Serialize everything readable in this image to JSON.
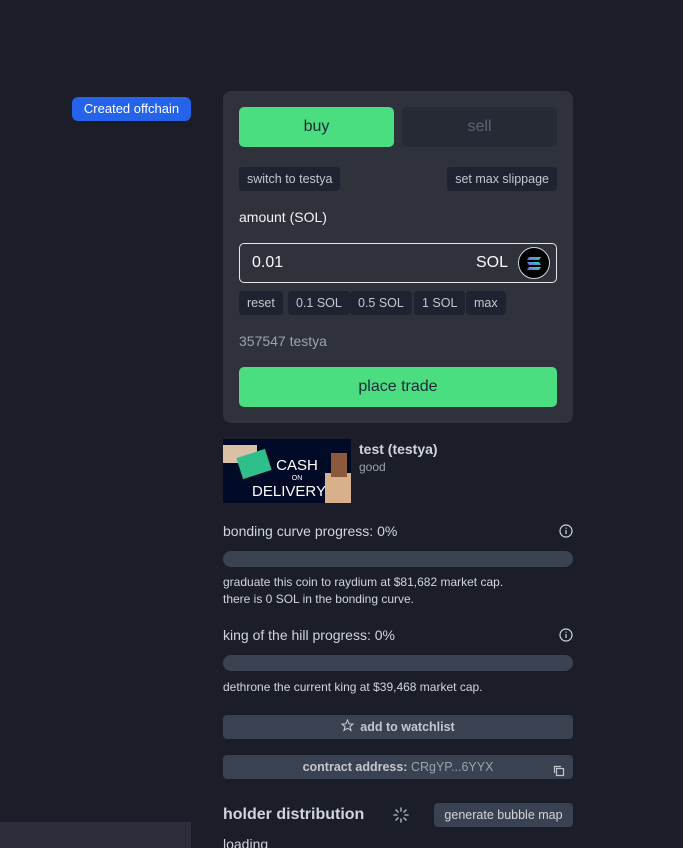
{
  "badge": {
    "label": "Created offchain"
  },
  "trade": {
    "tabs": {
      "buy": "buy",
      "sell": "sell"
    },
    "switch_label": "switch to testya",
    "slippage_label": "set max slippage",
    "amount_label": "amount (SOL)",
    "amount_value": "0.01",
    "amount_unit": "SOL",
    "quick_amounts": [
      "reset",
      "0.1 SOL",
      "0.5 SOL",
      "1 SOL",
      "max"
    ],
    "balance": "357547 testya",
    "submit_label": "place trade"
  },
  "coin": {
    "name": "test (testya)",
    "description": "good",
    "image_text": [
      "CASH",
      "ON",
      "DELIVERY"
    ]
  },
  "bonding": {
    "label": "bonding curve progress: 0%",
    "progress": 0,
    "note_1": "graduate this coin to raydium at $81,682 market cap.",
    "note_2": "there is 0 SOL in the bonding curve."
  },
  "king": {
    "label": "king of the hill progress: 0%",
    "progress": 0,
    "note": "dethrone the current king at $39,468 market cap."
  },
  "watchlist": {
    "label": "add to watchlist",
    "icon": "star-icon"
  },
  "contract": {
    "label": "contract address:",
    "value": "CRgYP...6YYX",
    "icon": "copy-icon"
  },
  "holders": {
    "title": "holder distribution",
    "bubble_map_label": "generate bubble map",
    "loading_text": "loading"
  },
  "colors": {
    "accent_green": "#4ade80",
    "badge_blue": "#2563eb",
    "panel_bg": "#2f313b",
    "page_bg": "#1b1d28"
  }
}
